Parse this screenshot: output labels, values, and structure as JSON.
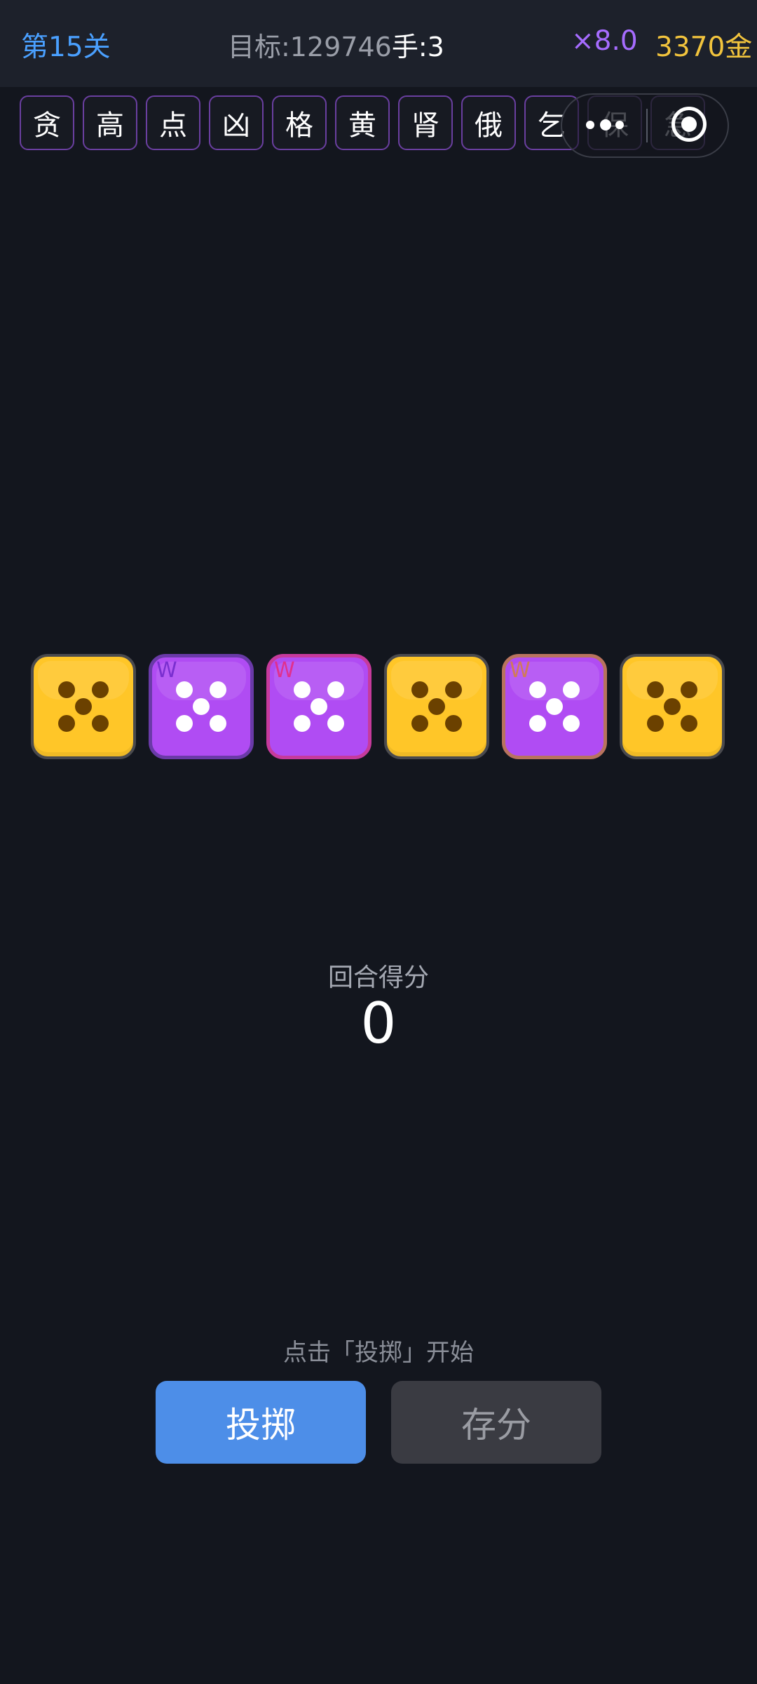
{
  "header": {
    "level": "第15关",
    "target": "目标:129746",
    "hand": "手:3",
    "multiplier": "×8.0",
    "gold": "3370金"
  },
  "modifiers": [
    "贪",
    "高",
    "点",
    "凶",
    "格",
    "黄",
    "肾",
    "俄",
    "乞",
    "保",
    "急"
  ],
  "overlay": {
    "more_icon": "more-dots-icon",
    "record_icon": "target-icon"
  },
  "dice": [
    {
      "value": 5,
      "color": "yellow",
      "mark": ""
    },
    {
      "value": 5,
      "color": "purple",
      "mark": "W",
      "mark_color": "#7a2fd0"
    },
    {
      "value": 5,
      "color": "purple",
      "mark": "W",
      "mark_color": "#e0308e"
    },
    {
      "value": 5,
      "color": "yellow",
      "mark": ""
    },
    {
      "value": 5,
      "color": "purple",
      "mark": "W",
      "mark_color": "#d07a5a"
    },
    {
      "value": 5,
      "color": "yellow",
      "mark": ""
    }
  ],
  "round_score": {
    "label": "回合得分",
    "value": "0"
  },
  "hint": "点击「投掷」开始",
  "buttons": {
    "roll": "投掷",
    "save": "存分"
  },
  "colors": {
    "accent_blue": "#4aa0ff",
    "multiplier_purple": "#a66cff",
    "gold": "#f2c43d",
    "roll_button": "#4d8ee8",
    "die_yellow": "#ffc628",
    "die_purple": "#b04cf3"
  }
}
